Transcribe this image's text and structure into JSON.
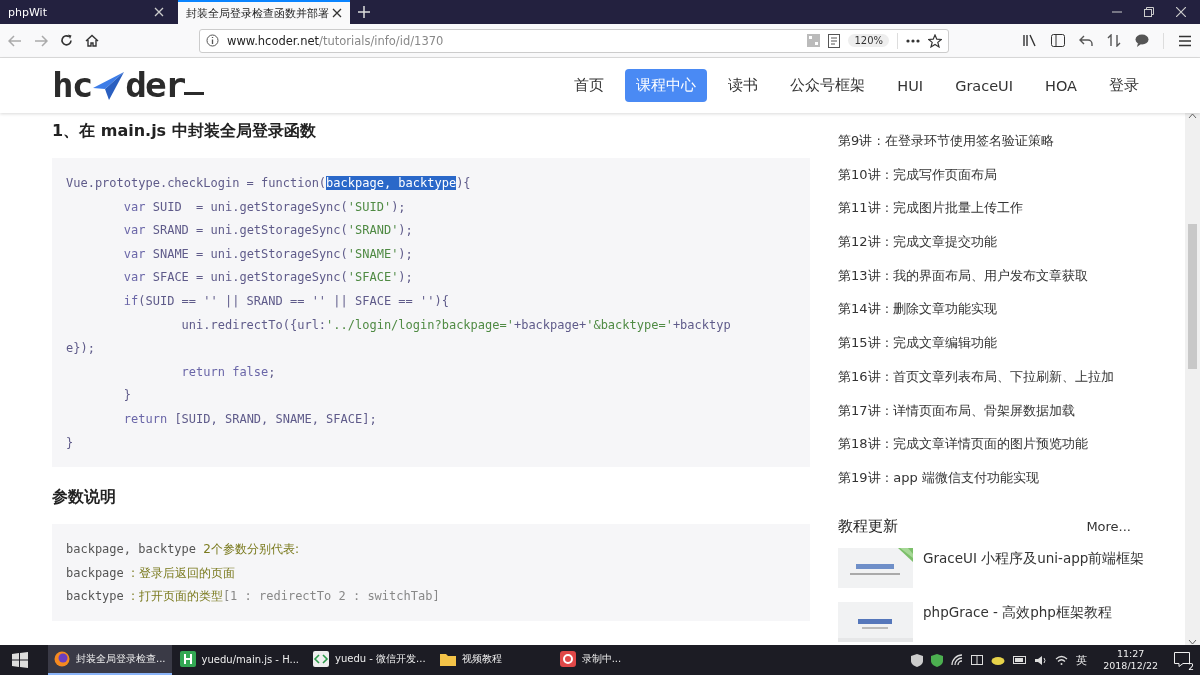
{
  "browser": {
    "tabs": [
      {
        "title": "phpWit",
        "selected": false
      },
      {
        "title": "封装全局登录检查函数并部署",
        "selected": true
      }
    ],
    "address": {
      "host": "www.hcoder.net",
      "path": "/tutorials/info/id/1370"
    },
    "zoom": "120%"
  },
  "site": {
    "logo": {
      "prefix": "hc",
      "suffix": "der"
    },
    "nav": [
      {
        "label": "首页",
        "selected": false
      },
      {
        "label": "课程中心",
        "selected": true
      },
      {
        "label": "读书",
        "selected": false
      },
      {
        "label": "公众号框架",
        "selected": false
      },
      {
        "label": "HUI",
        "selected": false
      },
      {
        "label": "GraceUI",
        "selected": false
      },
      {
        "label": "HOA",
        "selected": false
      },
      {
        "label": "登录",
        "selected": false
      }
    ]
  },
  "article": {
    "heading": "1、在 main.js 中封装全局登录函数",
    "code": [
      [
        {
          "kind": "code",
          "text": "Vue.prototype.checkLogin = function("
        },
        {
          "kind": "selected",
          "text": "backpage, backtype"
        },
        {
          "kind": "code",
          "text": "){"
        }
      ],
      [
        {
          "kind": "keyword",
          "text": "        var"
        },
        {
          "kind": "code",
          "text": " SUID  = uni.getStorageSync("
        },
        {
          "kind": "string",
          "text": "'SUID'"
        },
        {
          "kind": "code",
          "text": ");"
        }
      ],
      [
        {
          "kind": "keyword",
          "text": "        var"
        },
        {
          "kind": "code",
          "text": " SRAND = uni.getStorageSync("
        },
        {
          "kind": "string",
          "text": "'SRAND'"
        },
        {
          "kind": "code",
          "text": ");"
        }
      ],
      [
        {
          "kind": "keyword",
          "text": "        var"
        },
        {
          "kind": "code",
          "text": " SNAME = uni.getStorageSync("
        },
        {
          "kind": "string",
          "text": "'SNAME'"
        },
        {
          "kind": "code",
          "text": ");"
        }
      ],
      [
        {
          "kind": "keyword",
          "text": "        var"
        },
        {
          "kind": "code",
          "text": " SFACE = uni.getStorageSync("
        },
        {
          "kind": "string",
          "text": "'SFACE'"
        },
        {
          "kind": "code",
          "text": ");"
        }
      ],
      [
        {
          "kind": "keyword",
          "text": "        if"
        },
        {
          "kind": "code",
          "text": "(SUID == '' || SRAND == '' || SFACE == ''){"
        }
      ],
      [
        {
          "kind": "code",
          "text": "                uni.redirectTo({url:"
        },
        {
          "kind": "string",
          "text": "'../login/login?backpage='"
        },
        {
          "kind": "code",
          "text": "+backpage+"
        },
        {
          "kind": "string",
          "text": "'&backtype='"
        },
        {
          "kind": "code",
          "text": "+backtyp"
        }
      ],
      [
        {
          "kind": "code",
          "text": "e});"
        }
      ],
      [
        {
          "kind": "keyword",
          "text": "                return false"
        },
        {
          "kind": "code",
          "text": ";"
        }
      ],
      [
        {
          "kind": "code",
          "text": "        }"
        }
      ],
      [
        {
          "kind": "keyword",
          "text": "        return"
        },
        {
          "kind": "code",
          "text": " [SUID, SRAND, SNAME, SFACE];"
        }
      ],
      [
        {
          "kind": "code",
          "text": "}"
        }
      ]
    ],
    "params_heading": "参数说明",
    "params": [
      [
        {
          "kind": "plain",
          "text": "backpage, backtype "
        },
        {
          "kind": "note",
          "text": "2个参数分别代表:"
        }
      ],
      [
        {
          "kind": "plain",
          "text": "backpage "
        },
        {
          "kind": "note",
          "text": ": 登录后返回的页面"
        }
      ],
      [
        {
          "kind": "plain",
          "text": "backtype "
        },
        {
          "kind": "note",
          "text": ": 打开页面的类型"
        },
        {
          "kind": "punct",
          "text": "[1 : redirectTo 2 : switchTab]"
        }
      ]
    ]
  },
  "sidebar": {
    "lessons": [
      "第9讲 : 在登录环节使用签名验证策略",
      "第10讲 : 完成写作页面布局",
      "第11讲 : 完成图片批量上传工作",
      "第12讲 : 完成文章提交功能",
      "第13讲 : 我的界面布局、用户发布文章获取",
      "第14讲 : 删除文章功能实现",
      "第15讲 : 完成文章编辑功能",
      "第16讲 : 首页文章列表布局、下拉刷新、上拉加",
      "第17讲 : 详情页面布局、骨架屏数据加载",
      "第18讲 : 完成文章详情页面的图片预览功能",
      "第19讲 : app 端微信支付功能实现"
    ],
    "updates_title": "教程更新",
    "more": "More...",
    "updates": [
      {
        "title": "GraceUI 小程序及uni-app前端框架",
        "kind": "picture"
      },
      {
        "title": "phpGrace - 高效php框架教程",
        "kind": "picture"
      }
    ]
  },
  "taskbar": {
    "items": [
      {
        "label": "封装全局登录检查...",
        "selected": true
      },
      {
        "label": "yuedu/main.js - H...",
        "selected": false
      },
      {
        "label": "yuedu - 微信开发...",
        "selected": false
      },
      {
        "label": "视频教程",
        "selected": false
      },
      {
        "label": "录制中...",
        "selected": false
      }
    ],
    "ime": "英",
    "time": "11:27",
    "date": "2018/12/22",
    "notifications": "2"
  }
}
